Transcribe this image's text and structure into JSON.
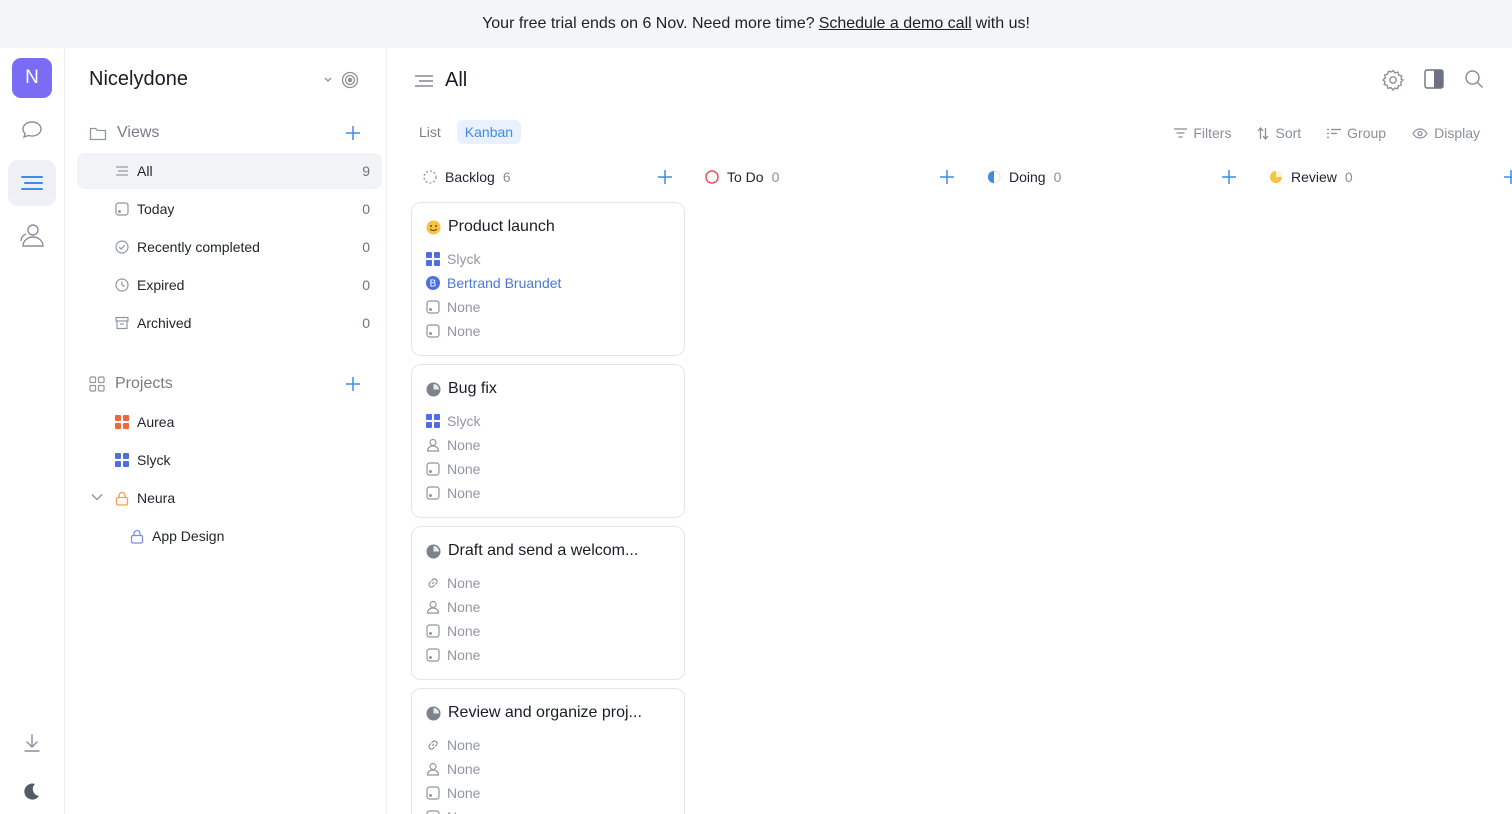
{
  "banner": {
    "prefix": "Your free trial ends on 6 Nov. Need more time?",
    "link": "Schedule a demo call",
    "suffix": "with us!"
  },
  "rail": {
    "avatar_letter": "N"
  },
  "sidebar": {
    "workspace": "Nicelydone",
    "views_label": "Views",
    "views": [
      {
        "label": "All",
        "count": "9"
      },
      {
        "label": "Today",
        "count": "0"
      },
      {
        "label": "Recently completed",
        "count": "0"
      },
      {
        "label": "Expired",
        "count": "0"
      },
      {
        "label": "Archived",
        "count": "0"
      }
    ],
    "projects_label": "Projects",
    "projects": [
      {
        "label": "Aurea",
        "color": "#f0683a"
      },
      {
        "label": "Slyck",
        "color": "#4f6fe0"
      },
      {
        "label": "Neura",
        "color": "#f0a24a"
      },
      {
        "label": "App Design",
        "color": "#7e8cf0"
      }
    ]
  },
  "main": {
    "title": "All",
    "tabs": {
      "list": "List",
      "kanban": "Kanban"
    },
    "toolbar": {
      "filters": "Filters",
      "sort": "Sort",
      "group": "Group",
      "display": "Display"
    },
    "columns": [
      {
        "name": "Backlog",
        "count": "6"
      },
      {
        "name": "To Do",
        "count": "0"
      },
      {
        "name": "Doing",
        "count": "0"
      },
      {
        "name": "Review",
        "count": "0"
      }
    ],
    "cards": [
      {
        "title": "Product launch",
        "props": [
          "Slyck",
          "Bertrand Bruandet",
          "None",
          "None"
        ]
      },
      {
        "title": "Bug fix",
        "props": [
          "Slyck",
          "None",
          "None",
          "None"
        ]
      },
      {
        "title": "Draft and send a welcom...",
        "props": [
          "None",
          "None",
          "None",
          "None"
        ]
      },
      {
        "title": "Review and organize proj...",
        "props": [
          "None",
          "None",
          "None",
          "N"
        ]
      }
    ]
  }
}
